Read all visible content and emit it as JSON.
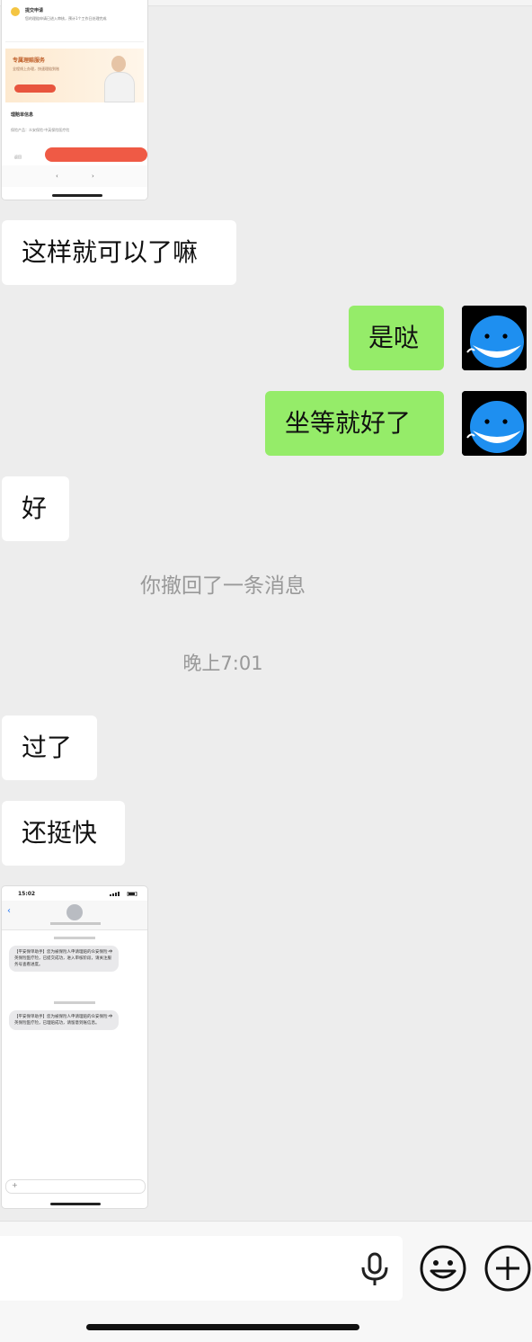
{
  "thumb_top": {
    "card_title": "提交申请",
    "card_text": "您的理赔申请已进入审核，预计1个工作日处理完成",
    "banner_title": "专属理赔服务",
    "banner_text": "全程线上办理，快速理赔到账",
    "section_title": "理赔单信息",
    "product_line": "保险产品：众安保险·中英保险医疗险",
    "left_label": "返回",
    "nav_prev": "‹",
    "nav_next": "›"
  },
  "messages": [
    {
      "side": "left",
      "text": "这样就可以了嘛"
    },
    {
      "side": "right",
      "text": "是哒"
    },
    {
      "side": "right",
      "text": "坐等就好了"
    },
    {
      "side": "left",
      "text": "好"
    },
    {
      "side": "left",
      "text": "过了"
    },
    {
      "side": "left",
      "text": "还挺快"
    }
  ],
  "system": {
    "recall_notice": "你撤回了一条消息",
    "timestamp": "晚上7:01"
  },
  "thumb_bottom": {
    "status_time": "15:02",
    "back_glyph": "‹",
    "sms_1": "【平安保单助手】您为被保险人申请理赔的众安保险·中英保险医疗险，已提交成功，进入审核阶段，请关注服务号查看进度。",
    "sms_2": "【平安保单助手】您为被保险人申请理赔的众安保险·中英保险医疗险，已理赔成功，请留意到账信息。",
    "plus_glyph": "+"
  },
  "colors": {
    "chat_bg": "#ededed",
    "bubble_self": "#95ec69",
    "bubble_other": "#ffffff",
    "avatar_whale": "#1e8ff0"
  },
  "icons": [
    "whale-avatar-icon",
    "voice-icon",
    "emoji-icon",
    "add-icon"
  ]
}
